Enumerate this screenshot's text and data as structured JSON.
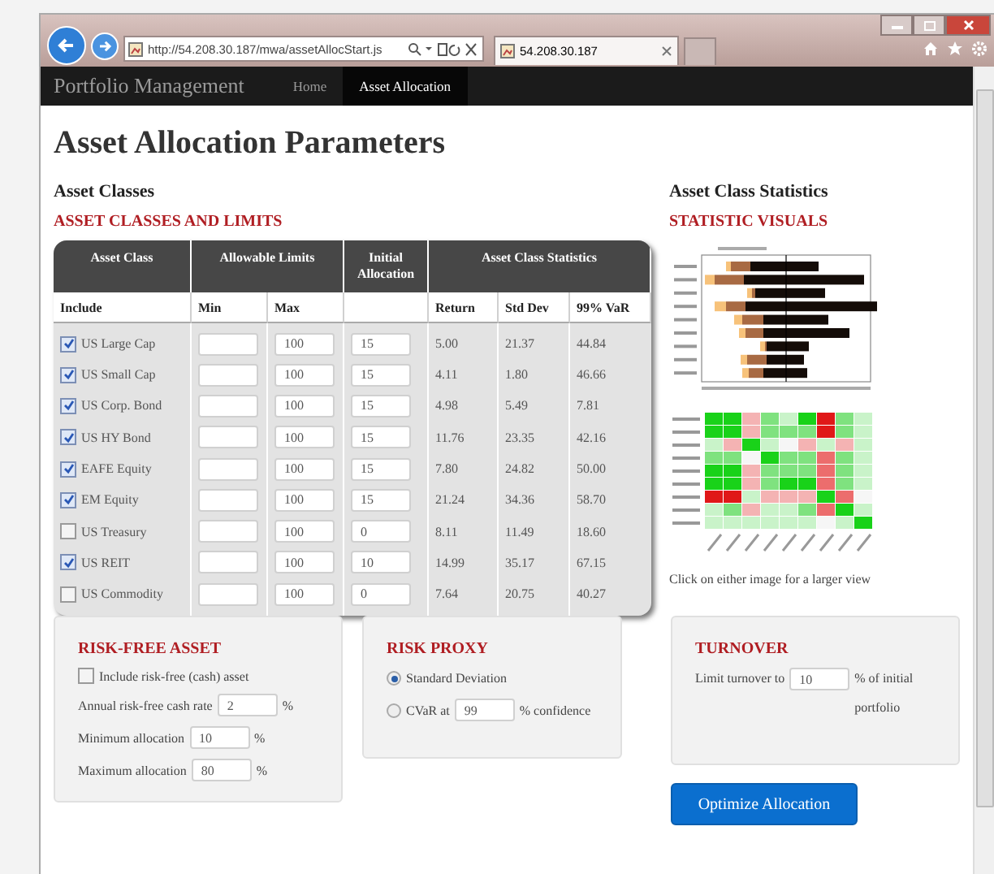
{
  "browser": {
    "address": "http://54.208.30.187/mwa/assetAllocStart.js",
    "tab_title": "54.208.30.187"
  },
  "navbar": {
    "brand": "Portfolio Management",
    "links": [
      {
        "label": "Home",
        "selected": false
      },
      {
        "label": "Asset Allocation",
        "selected": true
      }
    ]
  },
  "page_title": "Asset Allocation Parameters",
  "asset_classes": {
    "heading": "Asset Classes",
    "subheading": "ASSET CLASSES AND LIMITS",
    "group_headers": {
      "asset_class": "Asset Class",
      "limits": "Allowable Limits",
      "initial": "Initial Allocation",
      "statistics": "Asset Class Statistics"
    },
    "columns": {
      "include": "Include",
      "min": "Min",
      "max": "Max",
      "return": "Return",
      "std_dev": "Std Dev",
      "var": "99% VaR"
    },
    "rows": [
      {
        "name": "US Large Cap",
        "checked": true,
        "max": "100",
        "initial": "15",
        "return": "5.00",
        "std_dev": "21.37",
        "var": "44.84"
      },
      {
        "name": "US Small Cap",
        "checked": true,
        "max": "100",
        "initial": "15",
        "return": "4.11",
        "std_dev": "1.80",
        "var": "46.66"
      },
      {
        "name": "US Corp. Bond",
        "checked": true,
        "max": "100",
        "initial": "15",
        "return": "4.98",
        "std_dev": "5.49",
        "var": "7.81"
      },
      {
        "name": "US HY Bond",
        "checked": true,
        "max": "100",
        "initial": "15",
        "return": "11.76",
        "std_dev": "23.35",
        "var": "42.16"
      },
      {
        "name": "EAFE Equity",
        "checked": true,
        "max": "100",
        "initial": "15",
        "return": "7.80",
        "std_dev": "24.82",
        "var": "50.00"
      },
      {
        "name": "EM Equity",
        "checked": true,
        "max": "100",
        "initial": "15",
        "return": "21.24",
        "std_dev": "34.36",
        "var": "58.70"
      },
      {
        "name": "US Treasury",
        "checked": false,
        "max": "100",
        "initial": "0",
        "return": "8.11",
        "std_dev": "11.49",
        "var": "18.60"
      },
      {
        "name": "US REIT",
        "checked": true,
        "max": "100",
        "initial": "10",
        "return": "14.99",
        "std_dev": "35.17",
        "var": "67.15"
      },
      {
        "name": "US Commodity",
        "checked": false,
        "max": "100",
        "initial": "0",
        "return": "7.64",
        "std_dev": "20.75",
        "var": "40.27"
      }
    ]
  },
  "statistics": {
    "heading": "Asset Class Statistics",
    "subheading": "STATISTIC VISUALS",
    "caption": "Click on either image for a larger view"
  },
  "risk_free": {
    "heading": "RISK-FREE ASSET",
    "include": {
      "label": "Include risk-free (cash) asset",
      "checked": false
    },
    "fields": [
      {
        "label": "Annual risk-free cash rate",
        "value": "2",
        "unit": "%"
      },
      {
        "label": "Minimum allocation",
        "value": "10",
        "unit": "%"
      },
      {
        "label": "Maximum allocation",
        "value": "80",
        "unit": "%"
      }
    ]
  },
  "risk_proxy": {
    "heading": "RISK PROXY",
    "options": [
      {
        "label": "Standard Deviation",
        "selected": true
      },
      {
        "label": "CVaR at",
        "value": "99",
        "suffix": "% confidence",
        "selected": false
      }
    ]
  },
  "turnover": {
    "heading": "TURNOVER",
    "label": "Limit turnover to",
    "value": "10",
    "suffix": "% of initial portfolio"
  },
  "optimize_button": "Optimize Allocation"
}
